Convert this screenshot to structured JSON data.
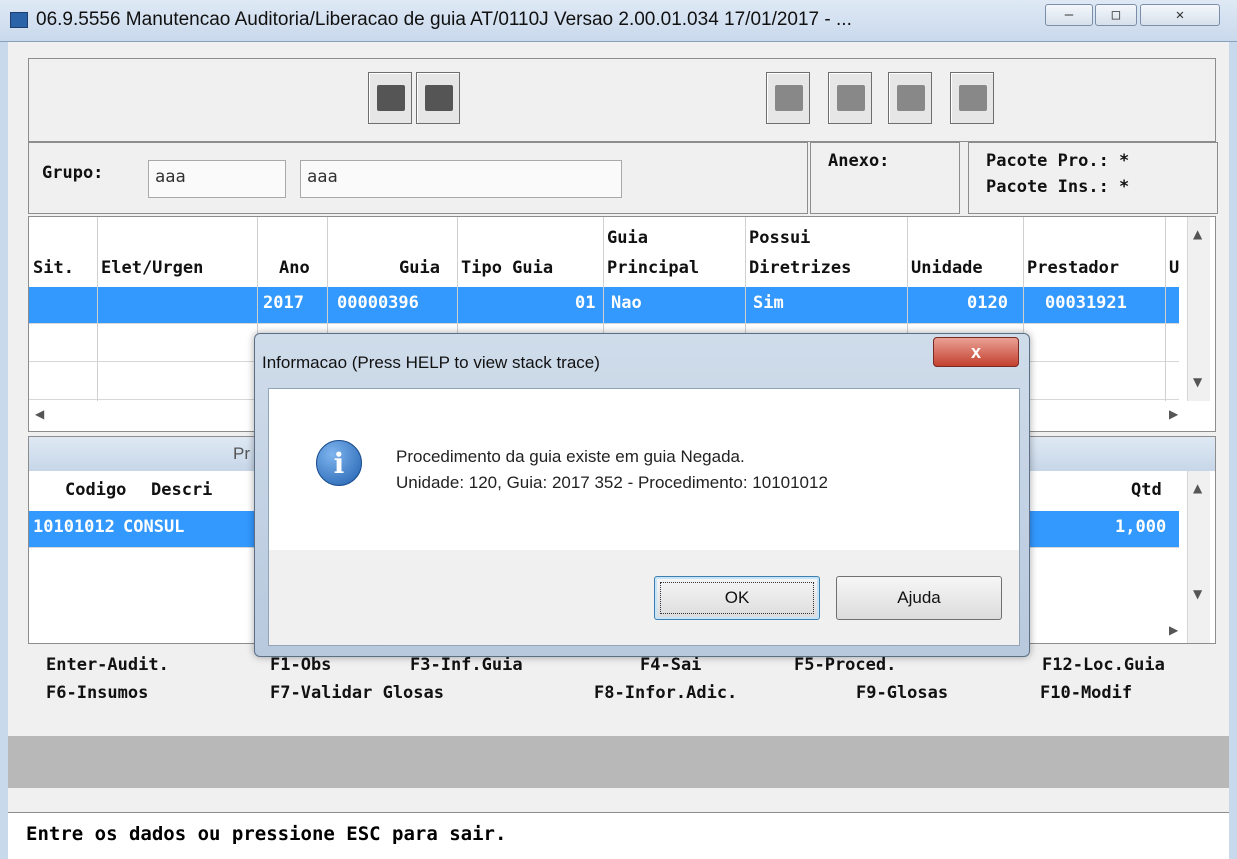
{
  "window": {
    "title": "06.9.5556 Manutencao  Auditoria/Liberacao de guia AT/0110J Versao 2.00.01.034 17/01/2017 - ...",
    "min": "—",
    "max": "□",
    "close": "✕"
  },
  "grupo": {
    "label": "Grupo:",
    "value1": "aaa",
    "value2": "aaa"
  },
  "anexo": {
    "label": "Anexo:"
  },
  "pacote": {
    "pro": "Pacote Pro.: *",
    "ins": "Pacote Ins.: *"
  },
  "grid": {
    "headers_top": {
      "guia_principal": "Guia",
      "possui": "Possui"
    },
    "headers": {
      "sit": "Sit.",
      "elet": "Elet/Urgen",
      "ano": "Ano",
      "guia": "Guia",
      "tipo": "Tipo Guia",
      "principal": "Principal",
      "diretrizes": "Diretrizes",
      "unidade": "Unidade",
      "prestador": "Prestador",
      "extra": "U"
    },
    "row1": {
      "ano": "2017",
      "guia": "00000396",
      "tipo": "01",
      "principal": "Nao",
      "diretrizes": "Sim",
      "unidade": "0120",
      "prestador": "00031921"
    }
  },
  "grid2": {
    "section_label": "Pr",
    "headers": {
      "codigo": "Codigo",
      "descricao": "Descri",
      "qtd": "Qtd"
    },
    "row1": {
      "codigo": "10101012",
      "descricao": "CONSUL",
      "qtd": "1,000"
    }
  },
  "function_keys": {
    "row1": [
      "Enter-Audit.",
      "F1-Obs",
      "F3-Inf.Guia",
      "F4-Sai",
      "F5-Proced.",
      "F12-Loc.Guia"
    ],
    "row2": [
      "F6-Insumos",
      "F7-Validar Glosas",
      "F8-Infor.Adic.",
      "F9-Glosas",
      "F10-Modif"
    ]
  },
  "status": "Entre os dados ou pressione ESC para sair.",
  "dialog": {
    "title": "Informacao (Press HELP to view stack trace)",
    "close": "x",
    "icon": "i",
    "line1": "Procedimento da guia existe em guia Negada.",
    "line2": "Unidade: 120, Guia: 2017 352 - Procedimento: 10101012",
    "ok": "OK",
    "help": "Ajuda"
  }
}
